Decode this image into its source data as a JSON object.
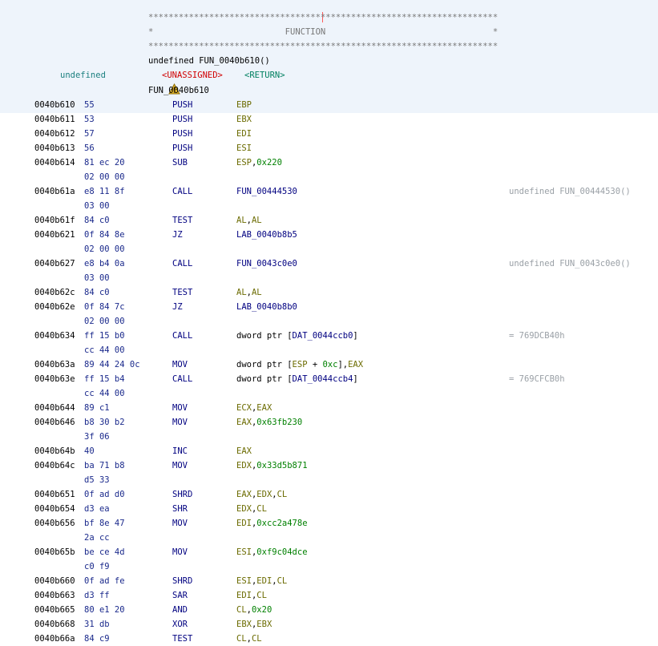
{
  "header": {
    "stars_line": "*********************************************************************",
    "function_line": "*                          FUNCTION                                 *",
    "signature": "undefined FUN_0040b610()",
    "return_type": "undefined",
    "unassigned": "<UNASSIGNED>",
    "return_label": "<RETURN>",
    "function_label": "FUN_0040b610"
  },
  "listing": [
    {
      "addr": "0040b610",
      "bytes": "55",
      "mn": "PUSH",
      "ops": [
        {
          "t": "EBP",
          "k": "reg"
        }
      ]
    },
    {
      "addr": "0040b611",
      "bytes": "53",
      "mn": "PUSH",
      "ops": [
        {
          "t": "EBX",
          "k": "reg"
        }
      ]
    },
    {
      "addr": "0040b612",
      "bytes": "57",
      "mn": "PUSH",
      "ops": [
        {
          "t": "EDI",
          "k": "reg"
        }
      ]
    },
    {
      "addr": "0040b613",
      "bytes": "56",
      "mn": "PUSH",
      "ops": [
        {
          "t": "ESI",
          "k": "reg"
        }
      ]
    },
    {
      "addr": "0040b614",
      "bytes": "81 ec 20",
      "mn": "SUB",
      "ops": [
        {
          "t": "ESP",
          "k": "reg"
        },
        {
          "t": ",",
          "k": "plain"
        },
        {
          "t": "0x220",
          "k": "num"
        }
      ]
    },
    {
      "addr": "",
      "bytes": "02 00 00",
      "mn": "",
      "ops": []
    },
    {
      "addr": "0040b61a",
      "bytes": "e8 11 8f",
      "mn": "CALL",
      "ops": [
        {
          "t": "FUN_00444530",
          "k": "lbl"
        }
      ],
      "comment": "undefined FUN_00444530()"
    },
    {
      "addr": "",
      "bytes": "03 00",
      "mn": "",
      "ops": []
    },
    {
      "addr": "0040b61f",
      "bytes": "84 c0",
      "mn": "TEST",
      "ops": [
        {
          "t": "AL",
          "k": "reg"
        },
        {
          "t": ",",
          "k": "plain"
        },
        {
          "t": "AL",
          "k": "reg"
        }
      ]
    },
    {
      "addr": "0040b621",
      "bytes": "0f 84 8e",
      "mn": "JZ",
      "ops": [
        {
          "t": "LAB_0040b8b5",
          "k": "lbl"
        }
      ]
    },
    {
      "addr": "",
      "bytes": "02 00 00",
      "mn": "",
      "ops": []
    },
    {
      "addr": "0040b627",
      "bytes": "e8 b4 0a",
      "mn": "CALL",
      "ops": [
        {
          "t": "FUN_0043c0e0",
          "k": "lbl"
        }
      ],
      "comment": "undefined FUN_0043c0e0()"
    },
    {
      "addr": "",
      "bytes": "03 00",
      "mn": "",
      "ops": []
    },
    {
      "addr": "0040b62c",
      "bytes": "84 c0",
      "mn": "TEST",
      "ops": [
        {
          "t": "AL",
          "k": "reg"
        },
        {
          "t": ",",
          "k": "plain"
        },
        {
          "t": "AL",
          "k": "reg"
        }
      ]
    },
    {
      "addr": "0040b62e",
      "bytes": "0f 84 7c",
      "mn": "JZ",
      "ops": [
        {
          "t": "LAB_0040b8b0",
          "k": "lbl"
        }
      ]
    },
    {
      "addr": "",
      "bytes": "02 00 00",
      "mn": "",
      "ops": []
    },
    {
      "addr": "0040b634",
      "bytes": "ff 15 b0",
      "mn": "CALL",
      "ops": [
        {
          "t": "dword ptr [",
          "k": "plain"
        },
        {
          "t": "DAT_0044ccb0",
          "k": "dat"
        },
        {
          "t": "]",
          "k": "plain"
        }
      ],
      "comment": "= 769DCB40h"
    },
    {
      "addr": "",
      "bytes": "cc 44 00",
      "mn": "",
      "ops": []
    },
    {
      "addr": "0040b63a",
      "bytes": "89 44 24 0c",
      "mn": "MOV",
      "ops": [
        {
          "t": "dword ptr [",
          "k": "plain"
        },
        {
          "t": "ESP",
          "k": "reg"
        },
        {
          "t": " + ",
          "k": "plain"
        },
        {
          "t": "0xc",
          "k": "num"
        },
        {
          "t": "],",
          "k": "plain"
        },
        {
          "t": "EAX",
          "k": "reg"
        }
      ]
    },
    {
      "addr": "0040b63e",
      "bytes": "ff 15 b4",
      "mn": "CALL",
      "ops": [
        {
          "t": "dword ptr [",
          "k": "plain"
        },
        {
          "t": "DAT_0044ccb4",
          "k": "dat"
        },
        {
          "t": "]",
          "k": "plain"
        }
      ],
      "comment": "= 769CFCB0h"
    },
    {
      "addr": "",
      "bytes": "cc 44 00",
      "mn": "",
      "ops": []
    },
    {
      "addr": "0040b644",
      "bytes": "89 c1",
      "mn": "MOV",
      "ops": [
        {
          "t": "ECX",
          "k": "reg"
        },
        {
          "t": ",",
          "k": "plain"
        },
        {
          "t": "EAX",
          "k": "reg"
        }
      ]
    },
    {
      "addr": "0040b646",
      "bytes": "b8 30 b2",
      "mn": "MOV",
      "ops": [
        {
          "t": "EAX",
          "k": "reg"
        },
        {
          "t": ",",
          "k": "plain"
        },
        {
          "t": "0x63fb230",
          "k": "num"
        }
      ]
    },
    {
      "addr": "",
      "bytes": "3f 06",
      "mn": "",
      "ops": []
    },
    {
      "addr": "0040b64b",
      "bytes": "40",
      "mn": "INC",
      "ops": [
        {
          "t": "EAX",
          "k": "reg"
        }
      ]
    },
    {
      "addr": "0040b64c",
      "bytes": "ba 71 b8",
      "mn": "MOV",
      "ops": [
        {
          "t": "EDX",
          "k": "reg"
        },
        {
          "t": ",",
          "k": "plain"
        },
        {
          "t": "0x33d5b871",
          "k": "num"
        }
      ]
    },
    {
      "addr": "",
      "bytes": "d5 33",
      "mn": "",
      "ops": []
    },
    {
      "addr": "0040b651",
      "bytes": "0f ad d0",
      "mn": "SHRD",
      "ops": [
        {
          "t": "EAX",
          "k": "reg"
        },
        {
          "t": ",",
          "k": "plain"
        },
        {
          "t": "EDX",
          "k": "reg"
        },
        {
          "t": ",",
          "k": "plain"
        },
        {
          "t": "CL",
          "k": "reg"
        }
      ]
    },
    {
      "addr": "0040b654",
      "bytes": "d3 ea",
      "mn": "SHR",
      "ops": [
        {
          "t": "EDX",
          "k": "reg"
        },
        {
          "t": ",",
          "k": "plain"
        },
        {
          "t": "CL",
          "k": "reg"
        }
      ]
    },
    {
      "addr": "0040b656",
      "bytes": "bf 8e 47",
      "mn": "MOV",
      "ops": [
        {
          "t": "EDI",
          "k": "reg"
        },
        {
          "t": ",",
          "k": "plain"
        },
        {
          "t": "0xcc2a478e",
          "k": "num"
        }
      ]
    },
    {
      "addr": "",
      "bytes": "2a cc",
      "mn": "",
      "ops": []
    },
    {
      "addr": "0040b65b",
      "bytes": "be ce 4d",
      "mn": "MOV",
      "ops": [
        {
          "t": "ESI",
          "k": "reg"
        },
        {
          "t": ",",
          "k": "plain"
        },
        {
          "t": "0xf9c04dce",
          "k": "num"
        }
      ]
    },
    {
      "addr": "",
      "bytes": "c0 f9",
      "mn": "",
      "ops": []
    },
    {
      "addr": "0040b660",
      "bytes": "0f ad fe",
      "mn": "SHRD",
      "ops": [
        {
          "t": "ESI",
          "k": "reg"
        },
        {
          "t": ",",
          "k": "plain"
        },
        {
          "t": "EDI",
          "k": "reg"
        },
        {
          "t": ",",
          "k": "plain"
        },
        {
          "t": "CL",
          "k": "reg"
        }
      ]
    },
    {
      "addr": "0040b663",
      "bytes": "d3 ff",
      "mn": "SAR",
      "ops": [
        {
          "t": "EDI",
          "k": "reg"
        },
        {
          "t": ",",
          "k": "plain"
        },
        {
          "t": "CL",
          "k": "reg"
        }
      ]
    },
    {
      "addr": "0040b665",
      "bytes": "80 e1 20",
      "mn": "AND",
      "ops": [
        {
          "t": "CL",
          "k": "reg"
        },
        {
          "t": ",",
          "k": "plain"
        },
        {
          "t": "0x20",
          "k": "num"
        }
      ]
    },
    {
      "addr": "0040b668",
      "bytes": "31 db",
      "mn": "XOR",
      "ops": [
        {
          "t": "EBX",
          "k": "reg"
        },
        {
          "t": ",",
          "k": "plain"
        },
        {
          "t": "EBX",
          "k": "reg"
        }
      ]
    },
    {
      "addr": "0040b66a",
      "bytes": "84 c9",
      "mn": "TEST",
      "ops": [
        {
          "t": "CL",
          "k": "reg"
        },
        {
          "t": ",",
          "k": "plain"
        },
        {
          "t": "CL",
          "k": "reg"
        }
      ]
    }
  ]
}
